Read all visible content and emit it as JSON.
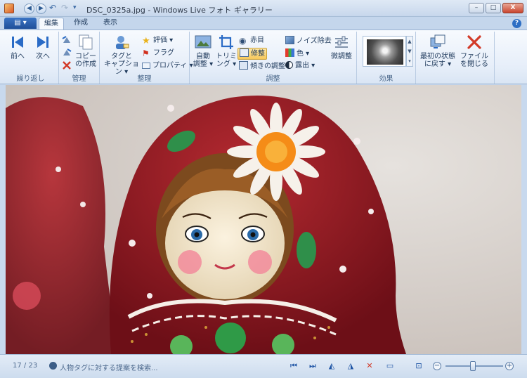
{
  "window": {
    "title": "DSC_0325a.jpg - Windows Live フォト ギャラリー",
    "minimize": "–",
    "maximize": "□",
    "close": "X"
  },
  "tabs": [
    {
      "label": "編集",
      "active": true
    },
    {
      "label": "作成",
      "active": false
    },
    {
      "label": "表示",
      "active": false
    }
  ],
  "app_menu_glyph": "▤ ▾",
  "help_glyph": "?",
  "ribbon": {
    "groups": {
      "navigate": {
        "label": "繰り返し",
        "prev": "前へ",
        "next": "次へ"
      },
      "manage": {
        "label": "管理",
        "copy": [
          "コピー",
          "の作成"
        ]
      },
      "organize": {
        "label": "整理",
        "tag_caption": [
          "タグと",
          "キャプション ▾"
        ],
        "rating": "評価 ▾",
        "flag": "フラグ",
        "properties": "プロパティ ▾"
      },
      "adjust": {
        "label": "調整",
        "auto": [
          "自動",
          "調整 ▾"
        ],
        "crop": [
          "トリミ",
          "ング ▾"
        ],
        "redeye": "赤目",
        "retouch": "修整",
        "straighten": "傾きの調整",
        "noise": "ノイズ除去",
        "color": "色 ▾",
        "exposure": "露出 ▾",
        "fine_tune": "微調整"
      },
      "effects": {
        "label": "効果",
        "scroll_up": "▲",
        "scroll_down": "▼",
        "scroll_more": "▾"
      },
      "revert": {
        "revert": [
          "最初の状態",
          "に戻す ▾"
        ],
        "close": [
          "ファイル",
          "を閉じる"
        ]
      }
    }
  },
  "status": {
    "count": "17 / 23",
    "text": "人物タグに対する提案を検索...",
    "zoom_fraction": 0.47
  },
  "colors": {
    "accent": "#2e6fc4",
    "doll_red": "#9b1a22",
    "background": "#d8d1cc"
  }
}
